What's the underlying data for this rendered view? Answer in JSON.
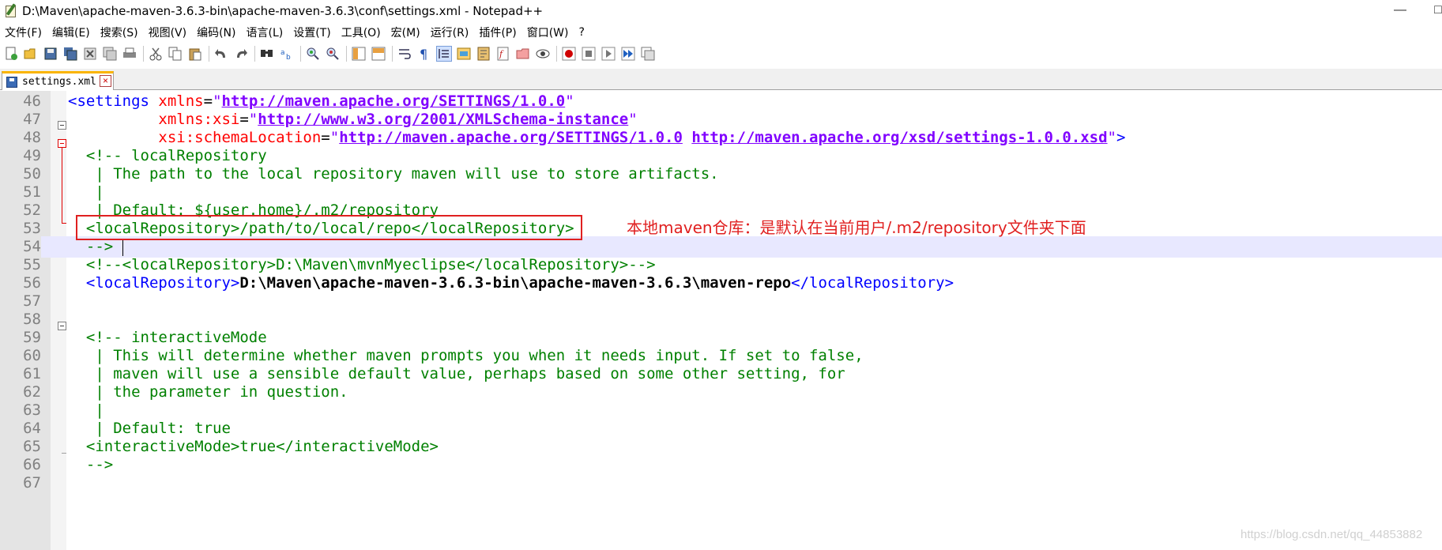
{
  "window": {
    "title": "D:\\Maven\\apache-maven-3.6.3-bin\\apache-maven-3.6.3\\conf\\settings.xml - Notepad++",
    "minimize_glyph": "—",
    "maximize_glyph": "□"
  },
  "menu": {
    "items": [
      {
        "label": "文件(F)"
      },
      {
        "label": "编辑(E)"
      },
      {
        "label": "搜索(S)"
      },
      {
        "label": "视图(V)"
      },
      {
        "label": "编码(N)"
      },
      {
        "label": "语言(L)"
      },
      {
        "label": "设置(T)"
      },
      {
        "label": "工具(O)"
      },
      {
        "label": "宏(M)"
      },
      {
        "label": "运行(R)"
      },
      {
        "label": "插件(P)"
      },
      {
        "label": "窗口(W)"
      },
      {
        "label": "?"
      }
    ]
  },
  "tab": {
    "label": "settings.xml",
    "close_glyph": "×"
  },
  "editor": {
    "line_numbers": [
      "46",
      "47",
      "48",
      "49",
      "50",
      "51",
      "52",
      "53",
      "54",
      "55",
      "56",
      "57",
      "58",
      "59",
      "60",
      "61",
      "62",
      "63",
      "64",
      "65",
      "66",
      "67"
    ],
    "lines": {
      "l46": {
        "lt": "<",
        "tagname": "settings",
        "attr": " xmlns",
        "eq": "=",
        "q1": "\"",
        "url": "http://maven.apache.org/SETTINGS/1.0.0",
        "q2": "\""
      },
      "l47": {
        "indent": "          ",
        "attr": "xmlns:xsi",
        "eq": "=",
        "q1": "\"",
        "url": "http://www.w3.org/2001/XMLSchema-instance",
        "q2": "\""
      },
      "l48": {
        "indent": "          ",
        "attr": "xsi:schemaLocation",
        "eq": "=",
        "q1": "\"",
        "url1": "http://maven.apache.org/SETTINGS/1.0.0",
        "sp": " ",
        "url2": "http://maven.apache.org/xsd/settings-1.0.0.xsd",
        "q2": "\"",
        "gt": ">"
      },
      "l49": "  <!-- localRepository",
      "l50": "   | The path to the local repository maven will use to store artifacts.",
      "l51": "   |",
      "l52": "   | Default: ${user.home}/.m2/repository",
      "l53": "  <localRepository>/path/to/local/repo</localRepository>",
      "l54": "  -->",
      "l55": "  <!--<localRepository>D:\\Maven\\mvnMyeclipse</localRepository>-->",
      "l56": {
        "indent": "  ",
        "open": "<localRepository>",
        "value": "D:\\Maven\\apache-maven-3.6.3-bin\\apache-maven-3.6.3\\maven-repo",
        "close": "</localRepository>"
      },
      "l57": "",
      "l58": "",
      "l59": "  <!-- interactiveMode",
      "l60": "   | This will determine whether maven prompts you when it needs input. If set to false,",
      "l61": "   | maven will use a sensible default value, perhaps based on some other setting, for",
      "l62": "   | the parameter in question.",
      "l63": "   |",
      "l64": "   | Default: true",
      "l65": "  <interactiveMode>true</interactiveMode>",
      "l66": "  -->"
    }
  },
  "annotation": {
    "text": "本地maven仓库：是默认在当前用户/.m2/repository文件夹下面"
  },
  "watermark": {
    "text": "https://blog.csdn.net/qq_44853882"
  },
  "colors": {
    "tag": "#0000ff",
    "attribute": "#ff0000",
    "attribute_value": "#8000ff",
    "comment": "#008000",
    "annotation": "#e02020",
    "current_line": "#e8e8ff"
  },
  "icons": [
    "new-file-icon",
    "open-file-icon",
    "save-icon",
    "save-all-icon",
    "close-icon",
    "close-all-icon",
    "print-icon",
    "cut-icon",
    "copy-icon",
    "paste-icon",
    "undo-icon",
    "redo-icon",
    "find-icon",
    "replace-icon",
    "zoom-in-icon",
    "zoom-out-icon",
    "sync-vertical-icon",
    "sync-horizontal-icon",
    "word-wrap-icon",
    "show-all-chars-icon",
    "indent-guide-icon",
    "udl-icon",
    "doc-map-icon",
    "function-list-icon",
    "folder-workspace-icon",
    "monitor-icon",
    "record-macro-icon",
    "stop-record-icon",
    "play-macro-icon",
    "run-macro-multiple-icon",
    "save-macro-icon"
  ]
}
